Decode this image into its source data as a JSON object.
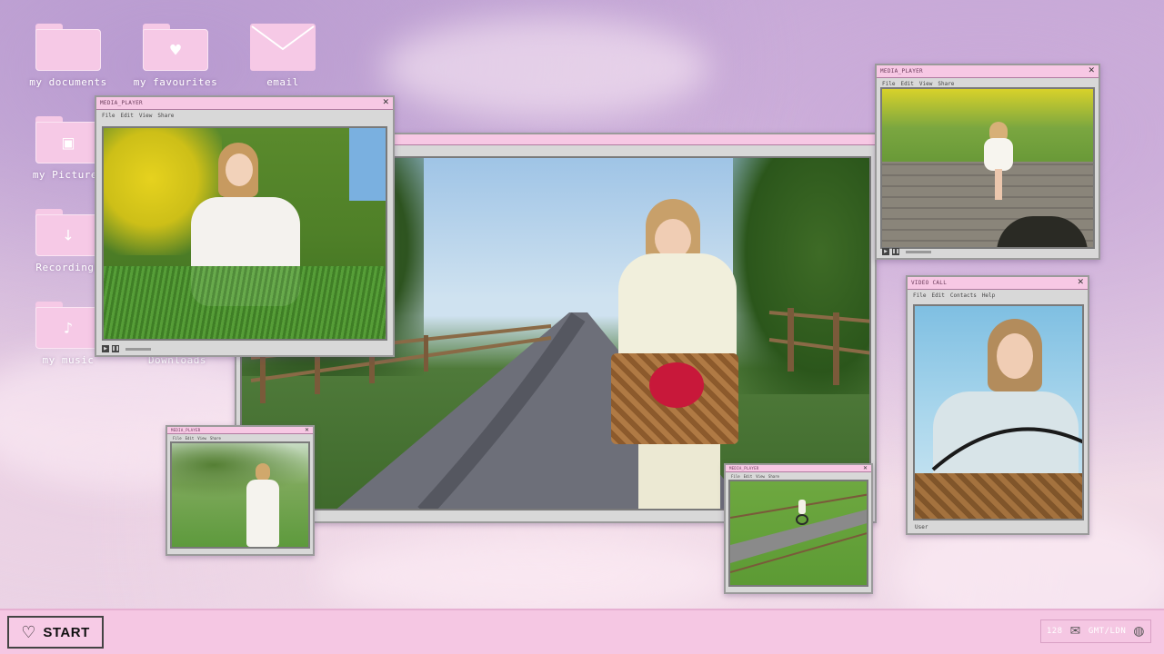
{
  "desktop": {
    "icons": [
      {
        "label": "my documents",
        "icon": "folder-icon"
      },
      {
        "label": "my favourites",
        "icon": "heart-folder-icon"
      },
      {
        "label": "email",
        "icon": "envelope-icon"
      },
      {
        "label": "my Pictures",
        "icon": "picture-folder-icon"
      },
      {
        "label": "Recordings",
        "icon": "download-folder-icon"
      },
      {
        "label": "my music",
        "icon": "music-folder-icon"
      },
      {
        "label": "Downloads",
        "icon": "folder-icon"
      }
    ]
  },
  "windows": {
    "media_player_left": {
      "title": "MEDIA_PLAYER",
      "menu": [
        "File",
        "Edit",
        "View",
        "Share"
      ]
    },
    "media_player_top_right": {
      "title": "MEDIA_PLAYER",
      "menu": [
        "File",
        "Edit",
        "View",
        "Share"
      ]
    },
    "video_call": {
      "title": "VIDEO CALL",
      "menu": [
        "File",
        "Edit",
        "Contacts",
        "Help"
      ],
      "footer_user": "User"
    },
    "media_player_small_left": {
      "title": "MEDIA_PLAYER",
      "menu": [
        "File",
        "Edit",
        "View",
        "Share"
      ]
    },
    "media_player_small_right": {
      "title": "MEDIA_PLAYER",
      "menu": [
        "File",
        "Edit",
        "View",
        "Share"
      ]
    }
  },
  "taskbar": {
    "start_label": "START",
    "tray_count": "128",
    "tray_clock": "GMT/LDN"
  },
  "colors": {
    "window_title": "#f7c8e4",
    "taskbar": "#f5c7e3",
    "window_frame": "#d8d8d8"
  }
}
